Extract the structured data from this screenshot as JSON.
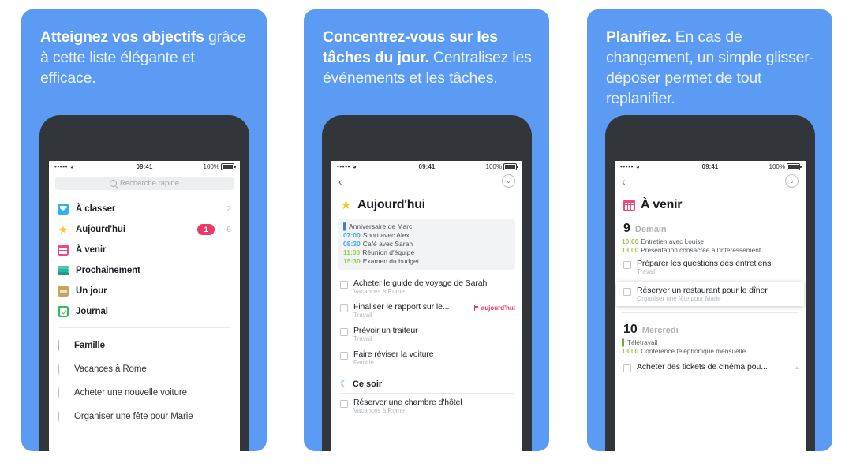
{
  "theme": {
    "panel_blue": "#5b9bf3",
    "phone_frame": "#32363b",
    "badge_pink": "#ec3b6b",
    "accent_green": "#9dc94c",
    "accent_blue": "#3ea6e8"
  },
  "panels": [
    {
      "promo_bold": "Atteignez vos objectifs",
      "promo_light": "grâce à cette liste élégante et efficace.",
      "statusbar": {
        "signal": "•••••",
        "wifi": "wifi-icon",
        "time": "09:41",
        "battery": "100%"
      },
      "search": {
        "placeholder": "Recherche rapide"
      },
      "nav_items": [
        {
          "icon": "inbox-icon",
          "label": "À classer",
          "count": "2",
          "badge": ""
        },
        {
          "icon": "star-icon",
          "label": "Aujourd'hui",
          "count": "6",
          "badge": "1"
        },
        {
          "icon": "calendar-icon",
          "label": "À venir",
          "count": "",
          "badge": ""
        },
        {
          "icon": "stack-icon",
          "label": "Prochainement",
          "count": "",
          "badge": ""
        },
        {
          "icon": "drawer-icon",
          "label": "Un jour",
          "count": "",
          "badge": ""
        },
        {
          "icon": "journal-icon",
          "label": "Journal",
          "count": "",
          "badge": ""
        }
      ],
      "projects": [
        {
          "icon": "hex-icon",
          "label": "Famille",
          "bold": true
        },
        {
          "icon": "pie-icon",
          "label": "Vacances à Rome",
          "bold": false
        },
        {
          "icon": "pie-icon",
          "label": "Acheter une nouvelle voiture",
          "bold": false
        },
        {
          "icon": "pie-icon",
          "label": "Organiser une fête pour Marie",
          "bold": false
        }
      ]
    },
    {
      "promo_bold": "Concentrez-vous sur les tâches du jour.",
      "promo_light": " Centralisez les événements et les tâches.",
      "statusbar": {
        "signal": "•••••",
        "wifi": "wifi-icon",
        "time": "09:41",
        "battery": "100%"
      },
      "toolbar": {
        "back": "‹",
        "collapse": "⌄"
      },
      "view_title": {
        "icon": "star-icon",
        "text": "Aujourd'hui"
      },
      "events": [
        {
          "time": "",
          "bar": true,
          "bar_color": "blue",
          "text": "Anniversaire de Marc"
        },
        {
          "time": "07:00",
          "color": "blue",
          "text": "Sport avec Alex"
        },
        {
          "time": "08:30",
          "color": "blue",
          "text": "Café avec Sarah"
        },
        {
          "time": "11:00",
          "color": "green",
          "text": "Réunion d'équipe"
        },
        {
          "time": "15:30",
          "color": "green",
          "text": "Examen du budget"
        }
      ],
      "tasks": [
        {
          "title": "Acheter le guide de voyage de Sarah",
          "sub": "Vacances à Rome",
          "tag": ""
        },
        {
          "title": "Finaliser le rapport sur le...",
          "sub": "Travail",
          "tag": "aujourd'hui"
        },
        {
          "title": "Prévoir un traiteur",
          "sub": "Travail",
          "tag": ""
        },
        {
          "title": "Faire réviser la voiture",
          "sub": "Famille",
          "tag": ""
        }
      ],
      "section": {
        "icon": "moon-icon",
        "title": "Ce soir"
      },
      "section_tasks": [
        {
          "title": "Réserver une chambre d'hôtel",
          "sub": "Vacances à Rome"
        }
      ]
    },
    {
      "promo_bold": "Planifiez.",
      "promo_light": " En cas de changement, un simple glisser-déposer permet de tout replanifier.",
      "statusbar": {
        "signal": "•••••",
        "wifi": "wifi-icon",
        "time": "09:41",
        "battery": "100%"
      },
      "toolbar": {
        "back": "‹",
        "collapse": "⌄"
      },
      "view_title": {
        "icon": "calendar-icon",
        "text": "À venir"
      },
      "days": [
        {
          "num": "9",
          "name": "Demain",
          "events": [
            {
              "time": "10:00",
              "color": "green",
              "text": "Entretien avec Louise"
            },
            {
              "time": "13:00",
              "color": "green",
              "text": "Présentation consacrée à l'intéressement"
            }
          ],
          "tasks": [
            {
              "title": "Préparer les questions des entretiens",
              "sub": "Travail",
              "dragging": false
            },
            {
              "title": "Réserver un restaurant pour le dîner",
              "sub": "Organiser une fête pour Marie",
              "dragging": true
            }
          ]
        },
        {
          "num": "10",
          "name": "Mercredi",
          "events": [
            {
              "time": "",
              "bar": true,
              "bar_color": "green",
              "text": "Télétravail"
            },
            {
              "time": "13:00",
              "color": "green",
              "text": "Conférence téléphonique mensuelle"
            }
          ],
          "tasks": [
            {
              "title": "Acheter des tickets de cinéma pou...",
              "sub": "",
              "dragging": false,
              "bell": "🔔"
            }
          ]
        }
      ]
    }
  ]
}
